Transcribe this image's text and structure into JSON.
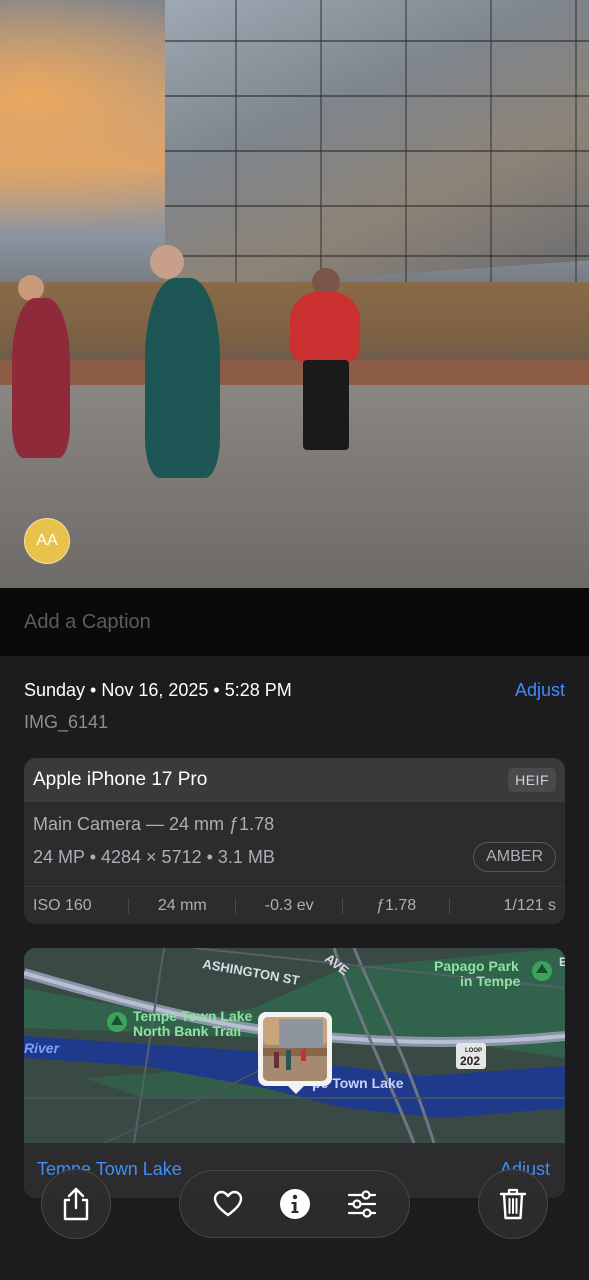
{
  "photo": {
    "avatar_initials": "AA"
  },
  "caption": {
    "placeholder": "Add a Caption"
  },
  "info": {
    "date": "Sunday • Nov 16, 2025 • 5:28 PM",
    "adjust_label": "Adjust",
    "filename": "IMG_6141",
    "device": "Apple iPhone 17 Pro",
    "format_badge": "HEIF",
    "lens": "Main Camera — 24 mm ƒ1.78",
    "specs": "24 MP • 4284 × 5712 • 3.1 MB",
    "profile_badge": "AMBER",
    "exif": [
      "ISO 160",
      "24 mm",
      "-0.3 ev",
      "ƒ1.78",
      "1/121 s"
    ]
  },
  "map": {
    "labels": {
      "street": "ASHINGTON ST",
      "ave": "AVE",
      "park": [
        "Papago Park",
        "in Tempe"
      ],
      "trail": [
        "Tempe Town Lake",
        "North Bank Trail"
      ],
      "river": "River",
      "lake": "pe Town Lake",
      "loop_top": "LOOP",
      "loop_num": "202",
      "edge": "E"
    },
    "place": "Tempe Town Lake",
    "adjust_label": "Adjust"
  },
  "toolbar": {
    "icons": [
      "share-icon",
      "heart-icon",
      "info-icon",
      "sliders-icon",
      "trash-icon"
    ]
  }
}
